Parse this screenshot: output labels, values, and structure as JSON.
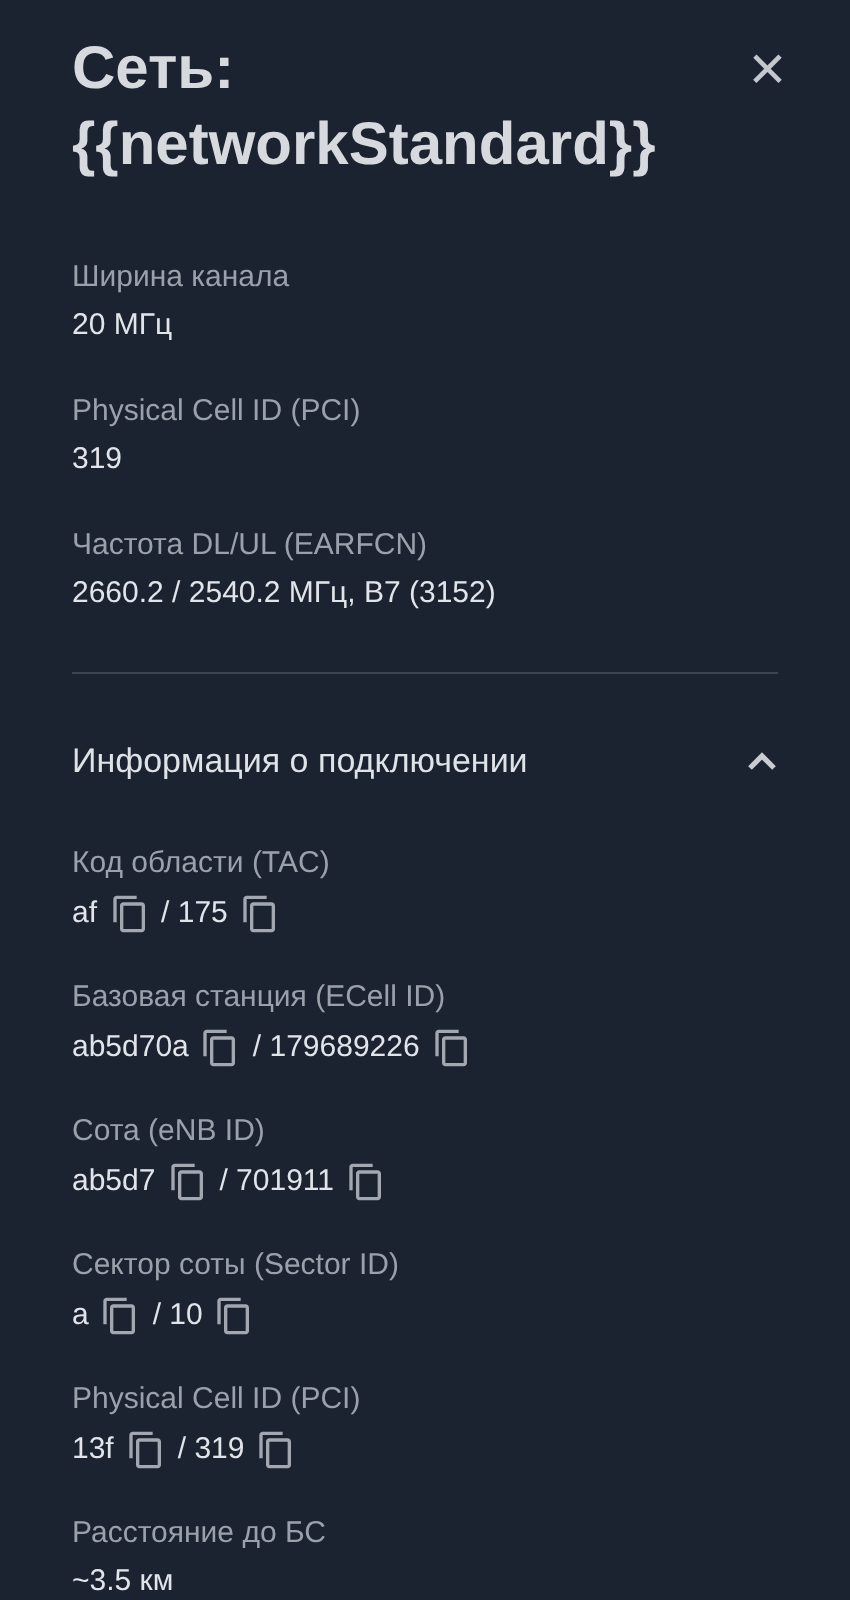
{
  "dialog": {
    "title": "Сеть: {{networkStandard}}",
    "close": "×"
  },
  "details": [
    {
      "label": "Ширина канала",
      "value": "20 МГц"
    },
    {
      "label": "Physical Cell ID (PCI)",
      "value": "319"
    },
    {
      "label": "Частота DL/UL (EARFCN)",
      "value": "2660.2 / 2540.2 МГц, B7 (3152)"
    }
  ],
  "connection_section": {
    "title": "Информация о подключении",
    "expanded": true,
    "fields": [
      {
        "label": "Код области (TAC)",
        "kind": "pair",
        "hex": "af",
        "decimal": "/ 175"
      },
      {
        "label": "Базовая станция (ECell ID)",
        "kind": "pair",
        "hex": "ab5d70a",
        "decimal": "/ 179689226"
      },
      {
        "label": "Сота (eNB ID)",
        "kind": "pair",
        "hex": "ab5d7",
        "decimal": "/ 701911"
      },
      {
        "label": "Сектор соты (Sector ID)",
        "kind": "pair",
        "hex": "a",
        "decimal": "/ 10"
      },
      {
        "label": "Physical Cell ID (PCI)",
        "kind": "pair",
        "hex": "13f",
        "decimal": "/ 319"
      },
      {
        "label": "Расстояние до БС",
        "kind": "text",
        "value": "~3.5 км"
      }
    ]
  }
}
